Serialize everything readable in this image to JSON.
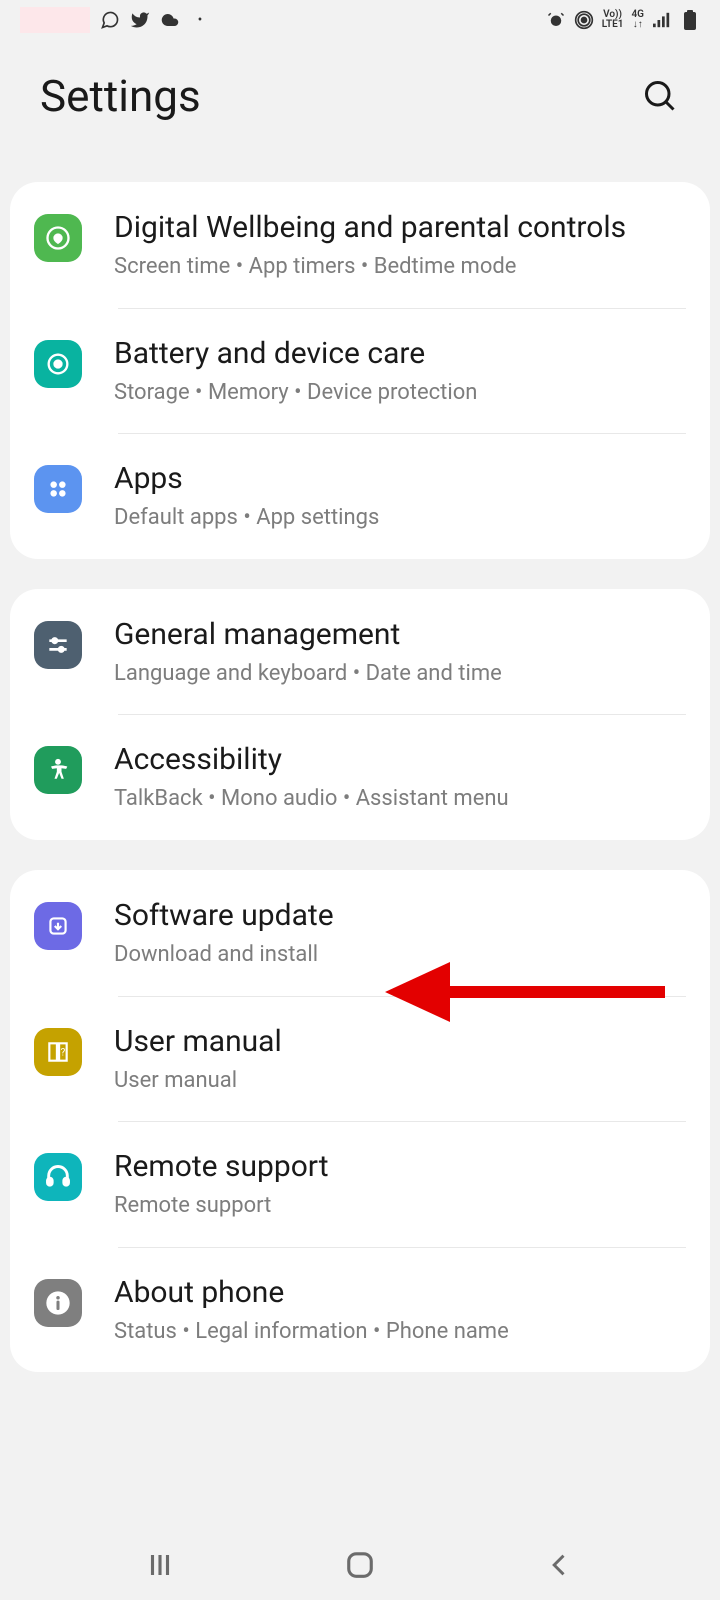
{
  "header": {
    "title": "Settings"
  },
  "status": {
    "net1": "Vo))",
    "net2": "LTE1",
    "net3": "4G"
  },
  "groups": [
    {
      "items": [
        {
          "title": "Digital Wellbeing and parental controls",
          "subtitle": "Screen time  •  App timers  •  Bedtime mode"
        },
        {
          "title": "Battery and device care",
          "subtitle": "Storage  •  Memory  •  Device protection"
        },
        {
          "title": "Apps",
          "subtitle": "Default apps  •  App settings"
        }
      ]
    },
    {
      "items": [
        {
          "title": "General management",
          "subtitle": "Language and keyboard  •  Date and time"
        },
        {
          "title": "Accessibility",
          "subtitle": "TalkBack  •  Mono audio  •  Assistant menu"
        }
      ]
    },
    {
      "items": [
        {
          "title": "Software update",
          "subtitle": "Download and install"
        },
        {
          "title": "User manual",
          "subtitle": "User manual"
        },
        {
          "title": "Remote support",
          "subtitle": "Remote support"
        },
        {
          "title": "About phone",
          "subtitle": "Status  •  Legal information  •  Phone name"
        }
      ]
    }
  ]
}
